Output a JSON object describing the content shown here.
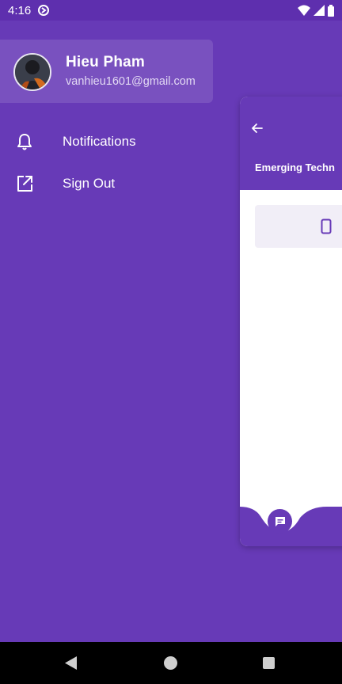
{
  "status_bar": {
    "time": "4:16",
    "icons": [
      "sync-icon",
      "wifi-icon",
      "signal-icon",
      "battery-icon"
    ]
  },
  "drawer": {
    "profile": {
      "name": "Hieu Pham",
      "email": "vanhieu1601@gmail.com",
      "avatar_icon": "avatar"
    },
    "items": [
      {
        "label": "Notifications",
        "icon": "bell-icon"
      },
      {
        "label": "Sign Out",
        "icon": "open-external-icon"
      }
    ]
  },
  "preview": {
    "title": "Emerging Techn",
    "back_icon": "arrow-back-icon",
    "tile_icon": "phone-icon",
    "fab_icon": "chat-icon"
  },
  "nav_bar": {
    "icons": [
      "back-icon",
      "home-icon",
      "recents-icon"
    ]
  },
  "colors": {
    "primary": "#673ab7",
    "status_bar": "#5e2fae",
    "card": "#ffffff",
    "nav_bar": "#000000"
  }
}
